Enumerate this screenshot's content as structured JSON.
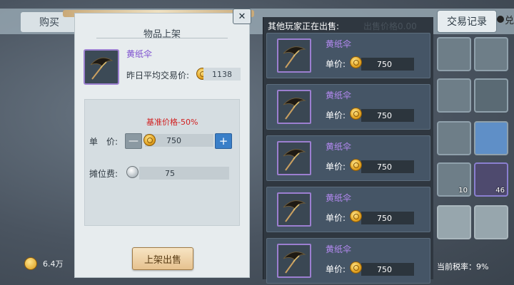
{
  "tabs": {
    "buy": "购买",
    "trade_record": "交易记录"
  },
  "top_right_char": "兑",
  "currency": {
    "amount": "6.4万"
  },
  "tax": {
    "label": "当前税率：",
    "value": "9%"
  },
  "inventory_counts": [
    "10",
    "46"
  ],
  "listing_panel": {
    "title": "物品上架",
    "item_name": "黄纸伞",
    "avg_price_label": "昨日平均交易价:",
    "avg_price_value": "1138",
    "base_price_label": "基准价格-50%",
    "unit_price_label": "单　价:",
    "unit_price_value": "750",
    "minus_label": "—",
    "plus_label": "+",
    "stall_fee_label": "摊位费:",
    "stall_fee_value": "75",
    "submit_label": "上架出售",
    "close_label": "✕"
  },
  "others_panel": {
    "title": "其他玩家正在出售:",
    "title_tail": "出售价格0.00",
    "listings": [
      {
        "name": "黄纸伞",
        "unit_label": "单价:",
        "price": "750"
      },
      {
        "name": "黄纸伞",
        "unit_label": "单价:",
        "price": "750"
      },
      {
        "name": "黄纸伞",
        "unit_label": "单价:",
        "price": "750"
      },
      {
        "name": "黄纸伞",
        "unit_label": "单价:",
        "price": "750"
      },
      {
        "name": "黄纸伞",
        "unit_label": "单价:",
        "price": "750"
      }
    ]
  }
}
